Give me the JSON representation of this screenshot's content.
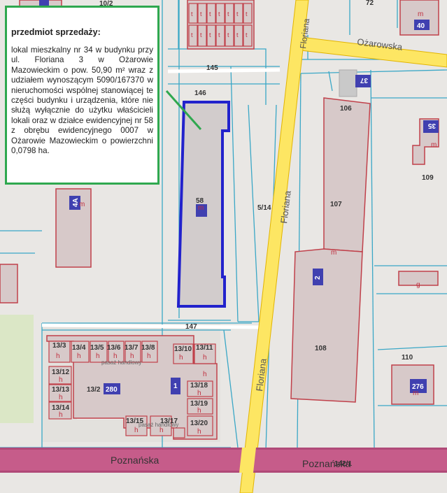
{
  "info_box": {
    "title": "przedmiot sprzedaży:",
    "body": "lokal mieszkalny nr 34 w budynku przy ul. Floriana 3 w Ożarowie Mazowieckim o pow. 50,90 m² wraz z udziałem wynoszącym 5090/167370 w nieruchomości wspólnej stanowiącej te części budynku i urządzenia, które nie służą wyłącznie do użytku właścicieli lokali oraz w działce ewidencyjnej nr 58 z obrębu ewidencyjnego 0007 w Ożarowie Mazowieckim o powierzchni 0,0798 ha."
  },
  "streets": {
    "floriana_top": "Floriana",
    "floriana_mid": "Floriana",
    "floriana_low": "Floriana",
    "ozarowska": "Ożarowska",
    "poznanska_left": "Poznańska",
    "poznanska_right": "Poznańska"
  },
  "parcels": {
    "p102": "10/2",
    "p72": "72",
    "p145": "145",
    "p146": "146",
    "p58": "58",
    "p514": "5/14",
    "p106": "106",
    "p107": "107",
    "p108": "108",
    "p109": "109",
    "p110": "110",
    "p147": "147",
    "p1421": "142/1",
    "p133": "13/3",
    "p134": "13/4",
    "p135": "13/5",
    "p136": "13/6",
    "p137": "13/7",
    "p138": "13/8",
    "p1310": "13/10",
    "p1311": "13/11",
    "p1312": "13/12",
    "p1313": "13/13",
    "p1314": "13/14",
    "p132": "13/2",
    "p1318": "13/18",
    "p1319": "13/19",
    "p1320": "13/20",
    "p1315": "13/15",
    "p1317": "13/17"
  },
  "building_numbers": {
    "b40": "40",
    "b37": "37",
    "b35": "35",
    "b2": "2",
    "b276": "276",
    "b280": "280",
    "b1": "1",
    "b4a": "4A"
  },
  "symbols": {
    "m": "m",
    "h": "h",
    "g": "g",
    "t": "t"
  },
  "passage": {
    "pasaz1": "pasaż handlowy",
    "pasaz2": "pasaż handlowy"
  },
  "colors": {
    "road_yellow": "#fde663",
    "road_edge": "#e2b400",
    "street_magenta": "#c65c8a",
    "parcel_line": "#3aa7c6",
    "building_fill": "#d7c9c9",
    "building_stroke": "#c0404a",
    "highlight_stroke": "#2222cc",
    "info_border": "#2fa84f",
    "badge_blue": "#4040b0",
    "background": "#e9e7e4"
  }
}
